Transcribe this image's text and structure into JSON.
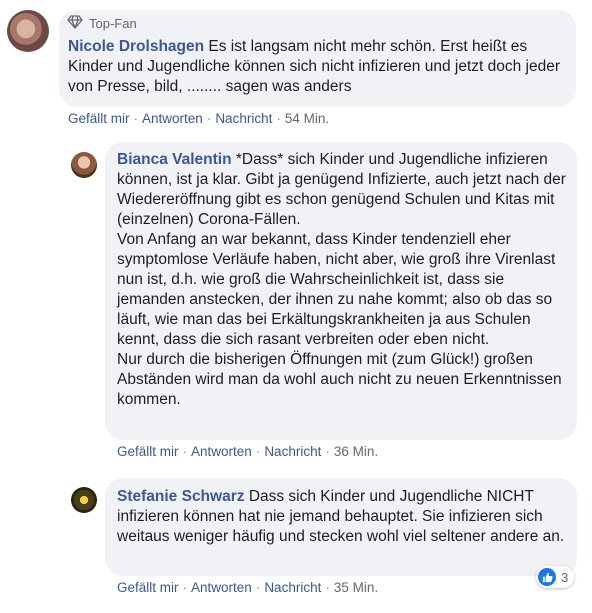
{
  "colors": {
    "author": "#385898",
    "bubble": "#f0f2f5",
    "meta": "#65676b",
    "like": "#1877f2"
  },
  "comments": [
    {
      "badge_icon": "diamond-icon",
      "badge": "Top-Fan",
      "author": "Nicole Drolshagen",
      "text": "Es ist langsam nicht mehr schön. Erst heißt es Kinder und Jugendliche können sich nicht infizieren und jetzt doch jeder von Presse, bild, ........ sagen was anders",
      "actions": {
        "like": "Gefällt mir",
        "reply": "Antworten",
        "message": "Nachricht",
        "time": "54 Min."
      }
    },
    {
      "author": "Bianca Valentin",
      "text": "*Dass* sich Kinder und Jugendliche infizieren können, ist ja klar. Gibt ja genügend Infizierte, auch jetzt nach der Wiedereröffnung gibt es schon genügend Schulen und Kitas mit (einzelnen) Corona-Fällen.\nVon Anfang an war bekannt, dass Kinder tendenziell eher symptomlose Verläufe haben, nicht aber, wie groß ihre Virenlast nun ist, d.h. wie groß die Wahrscheinlichkeit ist, dass sie jemanden anstecken, der ihnen zu nahe kommt; also ob das so läuft, wie man das bei Erkältungskrankheiten ja aus Schulen kennt, dass die sich rasant verbreiten oder eben nicht.\nNur durch die bisherigen Öffnungen mit (zum Glück!) großen Abständen wird man da wohl auch nicht zu neuen Erkenntnissen kommen.",
      "actions": {
        "like": "Gefällt mir",
        "reply": "Antworten",
        "message": "Nachricht",
        "time": "36 Min."
      }
    },
    {
      "author": "Stefanie Schwarz",
      "text": "Dass sich Kinder und Jugendliche NICHT infizieren können hat nie jemand behauptet. Sie infizieren sich weitaus weniger häufig und stecken wohl viel seltener andere an.",
      "actions": {
        "like": "Gefällt mir",
        "reply": "Antworten",
        "message": "Nachricht",
        "time": "35 Min."
      },
      "reactions": {
        "icon": "like-icon",
        "count": "3"
      }
    }
  ]
}
